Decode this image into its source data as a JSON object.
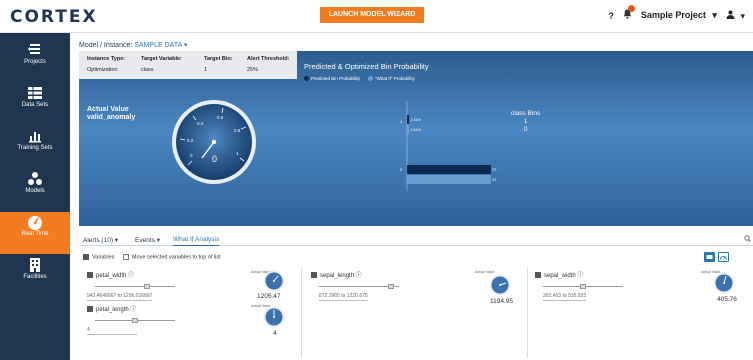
{
  "app": {
    "logo": "CORTEX",
    "launch_button": "LAUNCH MODEL WIZARD",
    "help": "?",
    "project": "Sample Project",
    "project_caret": "▾",
    "user_caret": "▾"
  },
  "sidebar": {
    "items": [
      {
        "label": "Projects",
        "icon": "projects-icon"
      },
      {
        "label": "Data Sets",
        "icon": "data-sets-icon"
      },
      {
        "label": "Training Sets",
        "icon": "training-sets-icon"
      },
      {
        "label": "Models",
        "icon": "models-icon"
      },
      {
        "label": "Real Time",
        "icon": "real-time-icon",
        "active": true
      },
      {
        "label": "Facilities",
        "icon": "facilities-icon"
      }
    ]
  },
  "instance": {
    "label": "Model / Instance:",
    "value": "SAMPLE DATA",
    "caret": "▾"
  },
  "info": {
    "headers": [
      "Instance Type:",
      "Target Variable:",
      "Target Bin:",
      "Alert Threshold:"
    ],
    "values": [
      "Optimization",
      "class",
      "1",
      "25%"
    ]
  },
  "prediction": {
    "title": "Predicted & Optimized Bin Probability",
    "legend": [
      {
        "name": "Predicted Bin Probability",
        "color": "#0d2a52"
      },
      {
        "name": "\"What If\" Probability",
        "color": "#6a9fd4"
      }
    ],
    "actual_label": "Actual Value",
    "actual_var": "valid_anomaly",
    "gauge_value": "0",
    "gauge_ticks": [
      "0",
      "0.2",
      "0.4",
      "0.6",
      "0.8",
      "1"
    ],
    "bins_label": "class Bins",
    "bins": [
      "1",
      "0"
    ],
    "axis_labels": [
      "1",
      "0"
    ],
    "bar_labels": [
      "2.41%",
      "2.41%",
      "97.59%",
      "97.59%"
    ]
  },
  "chart_data": {
    "type": "bar",
    "orientation": "horizontal",
    "categories": [
      "1",
      "0"
    ],
    "series": [
      {
        "name": "Predicted Bin Probability",
        "values": [
          2.41,
          97.59
        ]
      },
      {
        "name": "\"What If\" Probability",
        "values": [
          2.41,
          97.59
        ]
      }
    ],
    "title": "Predicted & Optimized Bin Probability",
    "xlabel": "",
    "ylabel": "",
    "colors": [
      "#0d2a52",
      "#6a9fd4"
    ]
  },
  "panel": {
    "tabs": [
      "Alerts (10)",
      "Events",
      "What If Analysis"
    ],
    "tab_caret": "▾",
    "variables_label": "Variables",
    "move_label": "Move selected variables to top of list"
  },
  "variables": [
    {
      "name": "petal_width",
      "range": "943.4646667 to 1296.016667",
      "actual_label": "Actual Value",
      "value": "1205.47",
      "slider_pos": 0.64
    },
    {
      "name": "petal_length",
      "range": "4",
      "actual_label": "Actual Value",
      "value": "4",
      "slider_pos": 0.5
    },
    {
      "name": "sepal_length",
      "range": "872.2965 to 1220.675",
      "actual_label": "Actual Value",
      "value": "1194.95",
      "slider_pos": 0.9
    },
    {
      "name": "sepal_width",
      "range": "303.453 to 535.933",
      "actual_label": "Actual Value",
      "value": "405.76",
      "slider_pos": 0.5
    }
  ]
}
